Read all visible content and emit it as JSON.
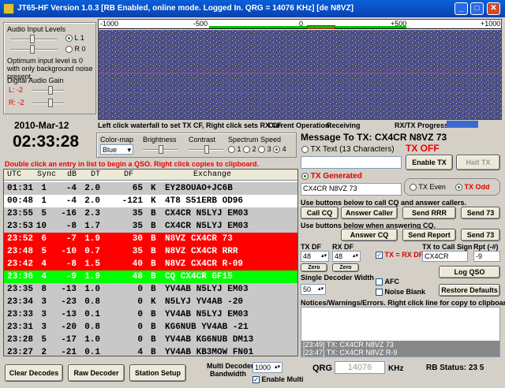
{
  "window": {
    "title": "JT65-HF Version 1.0.3  [RB Enabled,  online mode.  Logged In.  QRG = 14076 KHz] [de N8VZ]"
  },
  "audio": {
    "title": "Audio Input Levels",
    "l1": "L 1",
    "r0": "R 0",
    "hint": "Optimum input level is 0 with only background noise present.",
    "gain_title": "Digital Audio Gain",
    "gain_l": "L: -2",
    "gain_r": "R: -2"
  },
  "clock": {
    "date": "2010-Mar-12",
    "time": "02:33:28"
  },
  "waterfall": {
    "ticks": [
      "-1000",
      "-500",
      "0",
      "+500",
      "+1000"
    ],
    "info": "Left click waterfall to set TX CF, Right click sets RX CF.",
    "operation_label": "Current Operation:",
    "operation": "Receiving",
    "progress_label": "RX/TX Progress"
  },
  "display": {
    "colormap_label": "Color-map",
    "colormap_value": "Blue",
    "brightness_label": "Brightness",
    "contrast_label": "Contrast",
    "speed_label": "Spectrum Speed",
    "speeds": [
      "1",
      "2",
      "3",
      "4"
    ]
  },
  "instructions": "Double click an entry in list to begin a QSO.  Right click copies to clipboard.",
  "decodes": {
    "headers": [
      "UTC",
      "Sync",
      "dB",
      "DT",
      "DF",
      "Exchange"
    ],
    "rows": [
      {
        "utc": "01:31",
        "sync": "1",
        "db": "-4",
        "dt": "2.0",
        "df": "65",
        "k": "K",
        "ex": "EY28OUAO+JC6B",
        "bg": "#c8c8c8",
        "fg": "#000"
      },
      {
        "utc": "00:48",
        "sync": "1",
        "db": "-4",
        "dt": "2.0",
        "df": "-121",
        "k": "K",
        "ex": "4T8 S51ERB OD96",
        "bg": "#ffffff",
        "fg": "#000"
      },
      {
        "utc": "23:55",
        "sync": "5",
        "db": "-16",
        "dt": "2.3",
        "df": "35",
        "k": "B",
        "ex": "CX4CR N5LYJ EM03",
        "bg": "#c8c8c8",
        "fg": "#000"
      },
      {
        "utc": "23:53",
        "sync": "10",
        "db": "-8",
        "dt": "1.7",
        "df": "35",
        "k": "B",
        "ex": "CX4CR N5LYJ EM03",
        "bg": "#c8c8c8",
        "fg": "#000"
      },
      {
        "utc": "23:52",
        "sync": "6",
        "db": "-7",
        "dt": "1.9",
        "df": "30",
        "k": "B",
        "ex": "N8VZ CX4CR 73",
        "bg": "#ff0000",
        "fg": "#fff"
      },
      {
        "utc": "23:48",
        "sync": "5",
        "db": "-10",
        "dt": "0.7",
        "df": "35",
        "k": "B",
        "ex": "N8VZ CX4CR RRR",
        "bg": "#ff0000",
        "fg": "#fff"
      },
      {
        "utc": "23:42",
        "sync": "4",
        "db": "-8",
        "dt": "1.5",
        "df": "40",
        "k": "B",
        "ex": "N8VZ CX4CR R-09",
        "bg": "#ff0000",
        "fg": "#fff"
      },
      {
        "utc": "23:36",
        "sync": "4",
        "db": "-9",
        "dt": "1.9",
        "df": "48",
        "k": "B",
        "ex": "CQ CX4CR GF15",
        "bg": "#00ff00",
        "fg": "#fff"
      },
      {
        "utc": "23:35",
        "sync": "8",
        "db": "-13",
        "dt": "1.0",
        "df": "0",
        "k": "B",
        "ex": "YV4AB N5LYJ EM03",
        "bg": "#c8c8c8",
        "fg": "#000"
      },
      {
        "utc": "23:34",
        "sync": "3",
        "db": "-23",
        "dt": "0.8",
        "df": "0",
        "k": "K",
        "ex": "N5LYJ YV4AB -20",
        "bg": "#c8c8c8",
        "fg": "#000"
      },
      {
        "utc": "23:33",
        "sync": "3",
        "db": "-13",
        "dt": "0.1",
        "df": "0",
        "k": "B",
        "ex": "YV4AB N5LYJ EM03",
        "bg": "#c8c8c8",
        "fg": "#000"
      },
      {
        "utc": "23:31",
        "sync": "3",
        "db": "-20",
        "dt": "0.8",
        "df": "0",
        "k": "B",
        "ex": "KG6NUB YV4AB -21",
        "bg": "#c8c8c8",
        "fg": "#000"
      },
      {
        "utc": "23:28",
        "sync": "5",
        "db": "-17",
        "dt": "1.0",
        "df": "0",
        "k": "B",
        "ex": "YV4AB KG6NUB DM13",
        "bg": "#c8c8c8",
        "fg": "#000"
      },
      {
        "utc": "23:27",
        "sync": "2",
        "db": "-21",
        "dt": "0.1",
        "df": "4",
        "k": "B",
        "ex": "YV4AB KB3MOW FN01",
        "bg": "#c8c8c8",
        "fg": "#000"
      }
    ]
  },
  "bottom": {
    "clear": "Clear Decodes",
    "raw": "Raw Decoder",
    "station": "Station Setup",
    "mdb_label1": "Multi Decoder",
    "mdb_label2": "Bandwidth",
    "mdb_value": "1000",
    "enable_multi": "Enable Multi"
  },
  "tx": {
    "message_label": "Message To TX:",
    "message": "CX4CR N8VZ 73",
    "tx_text_label": "TX Text (13 Characters)",
    "tx_off": "TX OFF",
    "enable_tx": "Enable TX",
    "halt_tx": "Halt TX",
    "tx_generated_label": "TX Generated",
    "generated": "CX4CR N8VZ 73",
    "tx_even": "TX Even",
    "tx_odd": "TX Odd",
    "call_cq_info": "Use buttons below to call CQ and answer callers.",
    "call_cq": "Call CQ",
    "answer_caller": "Answer Caller",
    "send_rrr": "Send RRR",
    "send_73a": "Send 73",
    "answer_info": "Use buttons below when answering CQ.",
    "answer_cq": "Answer CQ",
    "send_report": "Send Report",
    "send_73b": "Send 73",
    "tx_df_label": "TX DF",
    "tx_df": "48",
    "rx_df_label": "RX DF",
    "rx_df": "48",
    "zero": "Zero",
    "tx_rx_df": "TX = RX DF",
    "callsign_label": "TX to Call Sign",
    "callsign": "CX4CR",
    "rpt_label": "Rpt (-#)",
    "rpt": "-9",
    "log_qso": "Log QSO",
    "sdw_label": "Single Decoder Width",
    "sdw": "50",
    "afc": "AFC",
    "noise_blank": "Noise Blank",
    "restore": "Restore Defaults",
    "notices_label": "Notices/Warnings/Errors.  Right click line for copy to clipboard.",
    "log": [
      "[23:49] TX: CX4CR N8VZ 73",
      "[23:47] TX: CX4CR N8VZ R-9"
    ],
    "qrg_label": "QRG",
    "qrg": "14076",
    "qrg_unit": "KHz",
    "rb_status": "RB Status: 23  5"
  }
}
